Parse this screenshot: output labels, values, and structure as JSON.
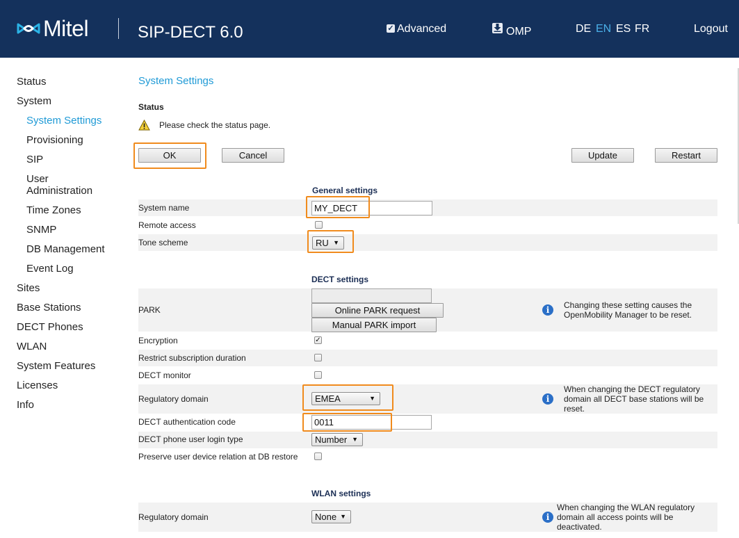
{
  "header": {
    "brand": "Mitel",
    "product": "SIP-DECT 6.0",
    "advanced_label": "Advanced",
    "omp_label": "OMP",
    "languages": [
      "DE",
      "EN",
      "ES",
      "FR"
    ],
    "active_language": "EN",
    "logout_label": "Logout"
  },
  "sidebar": {
    "items": [
      {
        "label": "Status"
      },
      {
        "label": "System"
      },
      {
        "label": "System Settings"
      },
      {
        "label": "Provisioning"
      },
      {
        "label": "SIP"
      },
      {
        "label": "User Administration"
      },
      {
        "label": "Time Zones"
      },
      {
        "label": "SNMP"
      },
      {
        "label": "DB Management"
      },
      {
        "label": "Event Log"
      },
      {
        "label": "Sites"
      },
      {
        "label": "Base Stations"
      },
      {
        "label": "DECT Phones"
      },
      {
        "label": "WLAN"
      },
      {
        "label": "System Features"
      },
      {
        "label": "Licenses"
      },
      {
        "label": "Info"
      }
    ]
  },
  "main": {
    "title": "System Settings",
    "status_title": "Status",
    "status_message": "Please check the status page.",
    "buttons": {
      "ok": "OK",
      "cancel": "Cancel",
      "update": "Update",
      "restart": "Restart"
    }
  },
  "general": {
    "title": "General settings",
    "system_name_label": "System name",
    "system_name_value": "MY_DECT",
    "remote_access_label": "Remote access",
    "remote_access_checked": false,
    "tone_scheme_label": "Tone scheme",
    "tone_scheme_value": "RU"
  },
  "dect": {
    "title": "DECT settings",
    "park_label": "PARK",
    "park_value": "",
    "online_park_label": "Online PARK request",
    "manual_park_label": "Manual PARK import",
    "park_note": "Changing these setting causes the OpenMobility Manager to be reset.",
    "encryption_label": "Encryption",
    "encryption_checked": true,
    "restrict_label": "Restrict subscription duration",
    "monitor_label": "DECT monitor",
    "regulatory_label": "Regulatory domain",
    "regulatory_value": "EMEA",
    "regulatory_note": "When changing the DECT regulatory domain all DECT base stations will be reset.",
    "auth_label": "DECT authentication code",
    "auth_value": "0011",
    "login_type_label": "DECT phone user login type",
    "login_type_value": "Number",
    "preserve_label": "Preserve user device relation at DB restore"
  },
  "wlan": {
    "title": "WLAN settings",
    "regulatory_label": "Regulatory domain",
    "regulatory_value": "None",
    "regulatory_note": "When changing the WLAN regulatory domain all access points will be deactivated."
  },
  "colors": {
    "header_bg": "#14315c",
    "accent": "#1f9ad6",
    "highlight": "#f08b1d",
    "info": "#2b6fc7"
  }
}
